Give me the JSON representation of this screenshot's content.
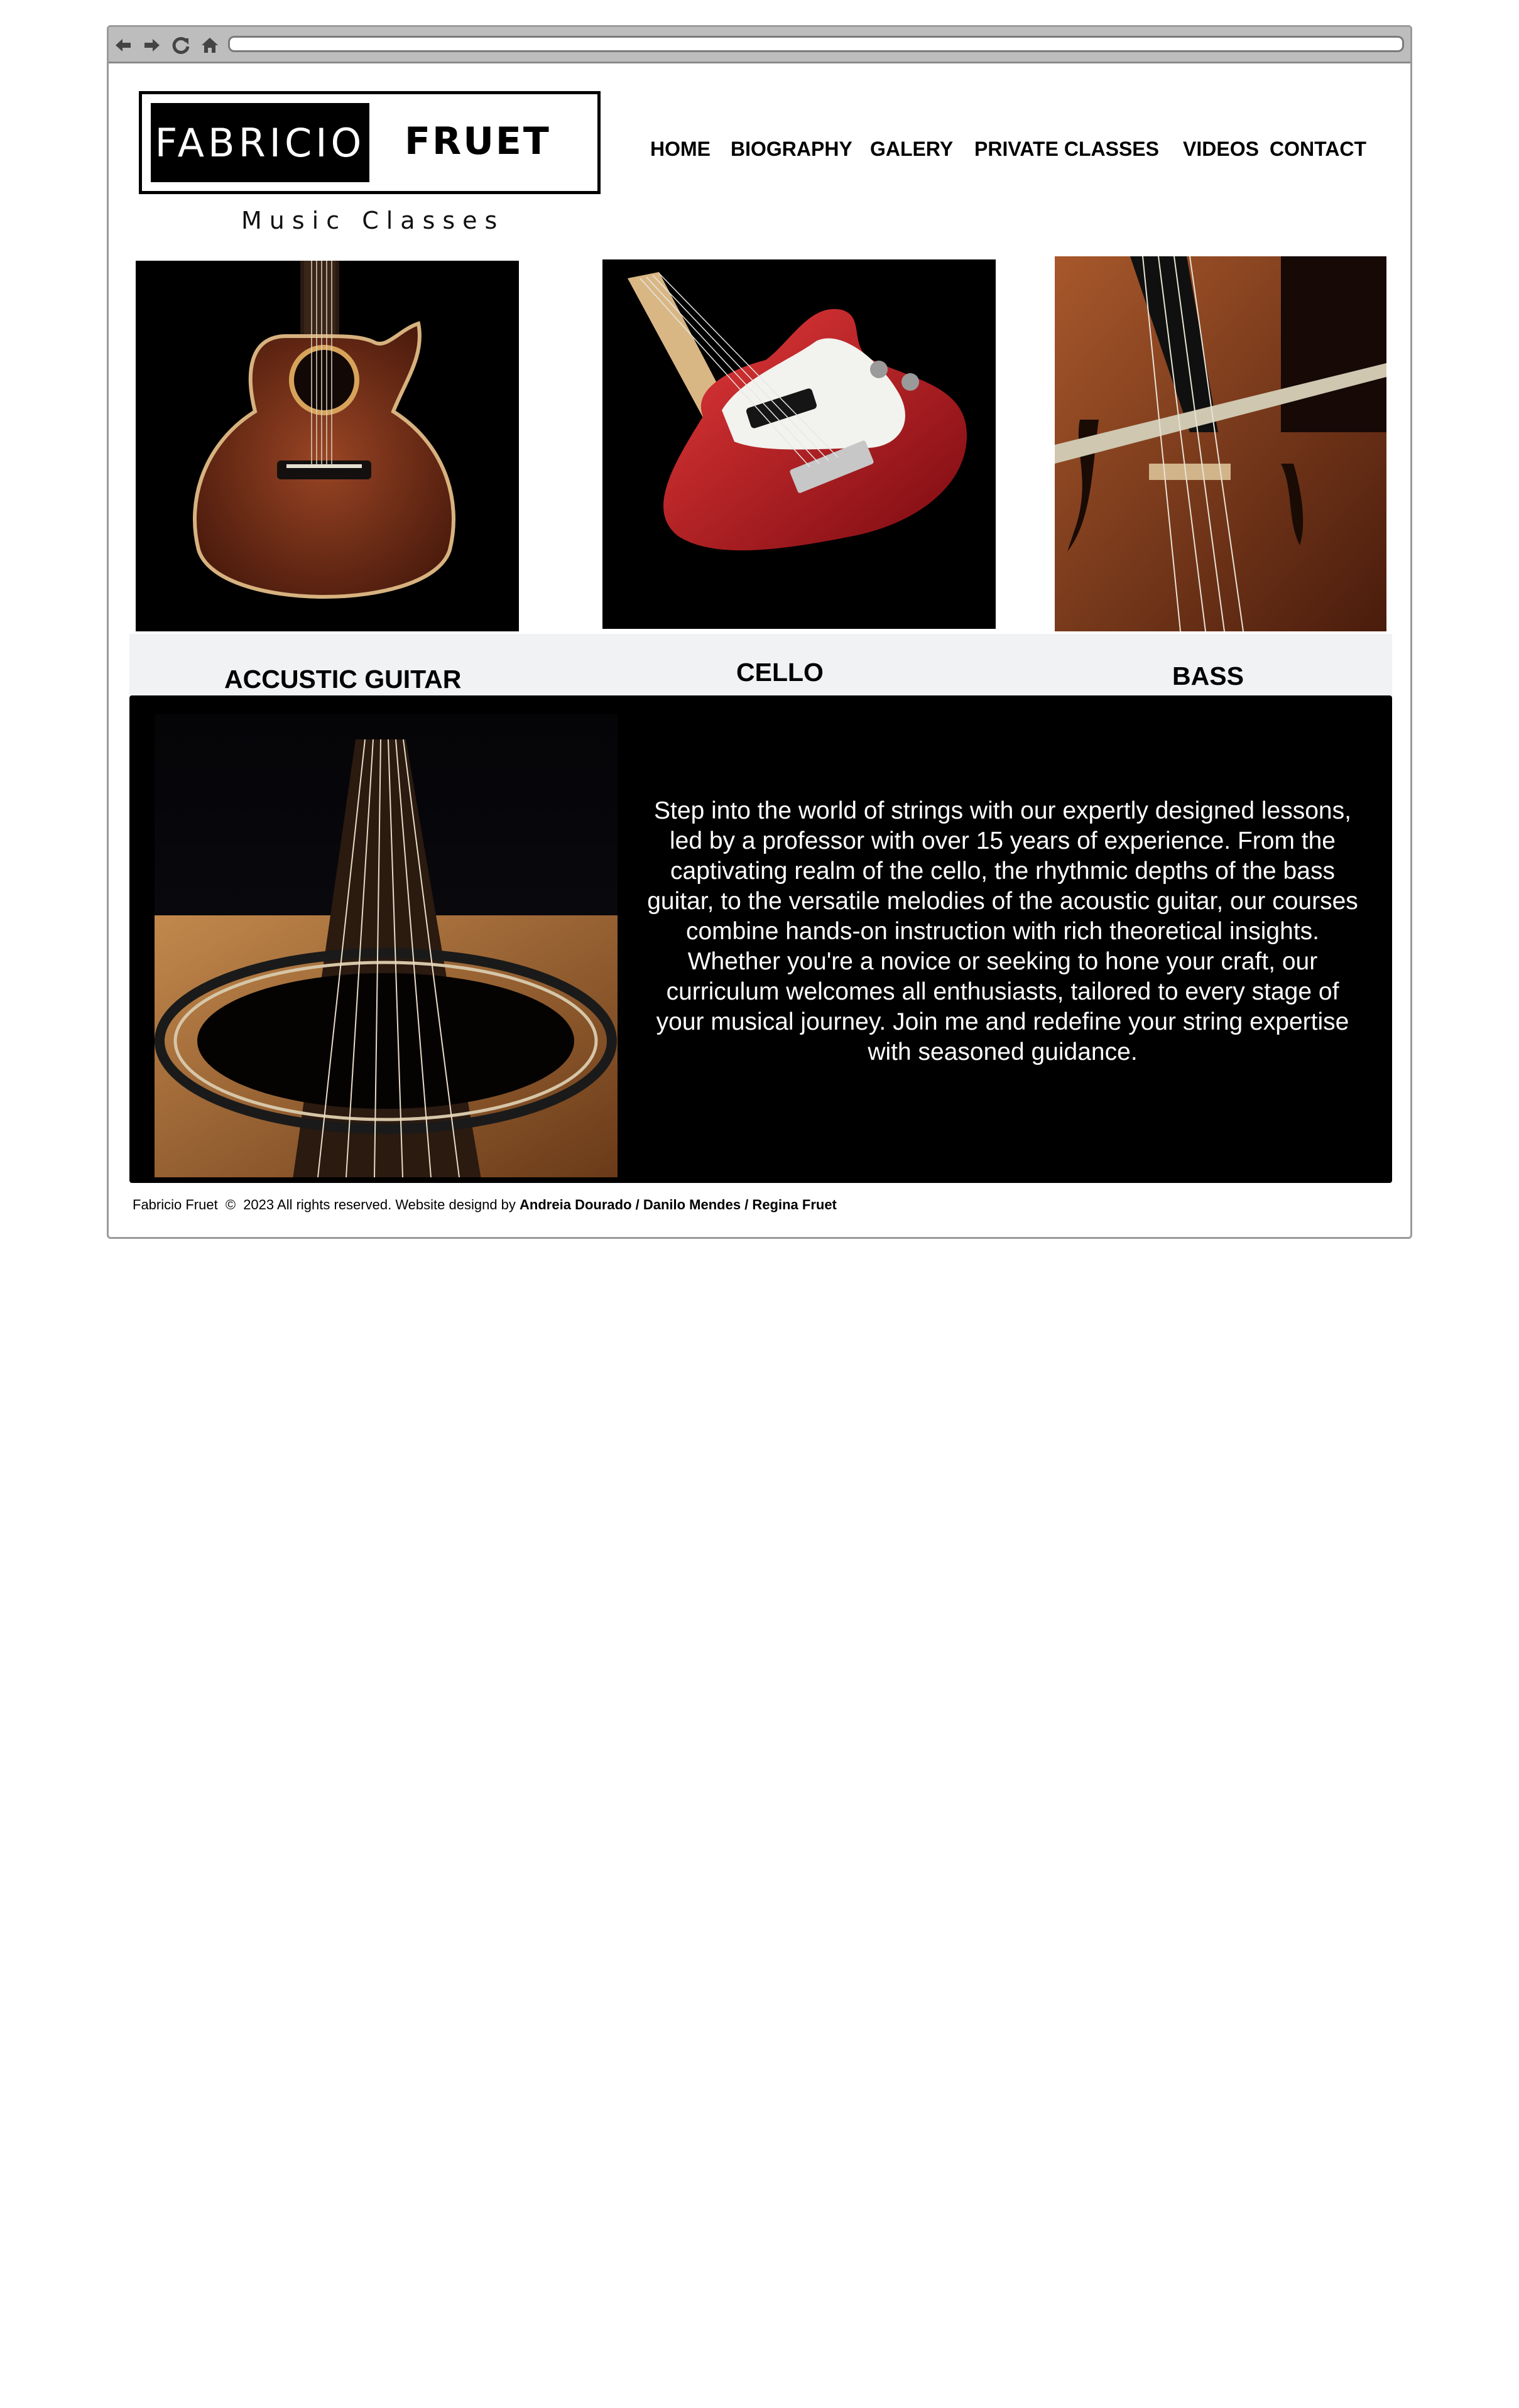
{
  "browser": {
    "icons": [
      "back-icon",
      "forward-icon",
      "reload-icon",
      "home-icon"
    ],
    "address": ""
  },
  "logo": {
    "left_text": "FABRICIO",
    "right_text": "FRUET",
    "subtitle": "Music Classes"
  },
  "nav": {
    "items": [
      "HOME",
      "BIOGRAPHY",
      "GALERY",
      "PRIVATE CLASSES",
      "VIDEOS",
      "CONTACT"
    ]
  },
  "instruments": {
    "images": [
      "acoustic-guitar-photo",
      "bass-guitar-photo",
      "cello-photo"
    ],
    "labels": [
      "ACCUSTIC GUITAR",
      "CELLO",
      "BASS"
    ]
  },
  "intro": {
    "text": "Step into the world of strings with our expertly designed lessons, led by a professor with over 15 years of experience. From the captivating realm of the cello, the rhythmic depths of the bass guitar, to the versatile melodies of the acoustic guitar, our courses combine hands-on instruction with rich theoretical insights. Whether you're a novice or seeking to hone your craft, our curriculum welcomes all enthusiasts, tailored to every stage of your musical journey. Join me and redefine your string expertise with seasoned guidance."
  },
  "footer": {
    "owner": "Fabricio Fruet",
    "copyright_symbol": "©",
    "rights": "2023 All rights reserved. Website designd by",
    "designers": "Andreia Dourado / Danilo Mendes / Regina Fruet"
  },
  "colors": {
    "chrome": "#bdbdbd",
    "label_bar": "#f1f2f4",
    "panel": "#000000",
    "bass_red": "#b3121c",
    "wood": "#7a3318"
  }
}
